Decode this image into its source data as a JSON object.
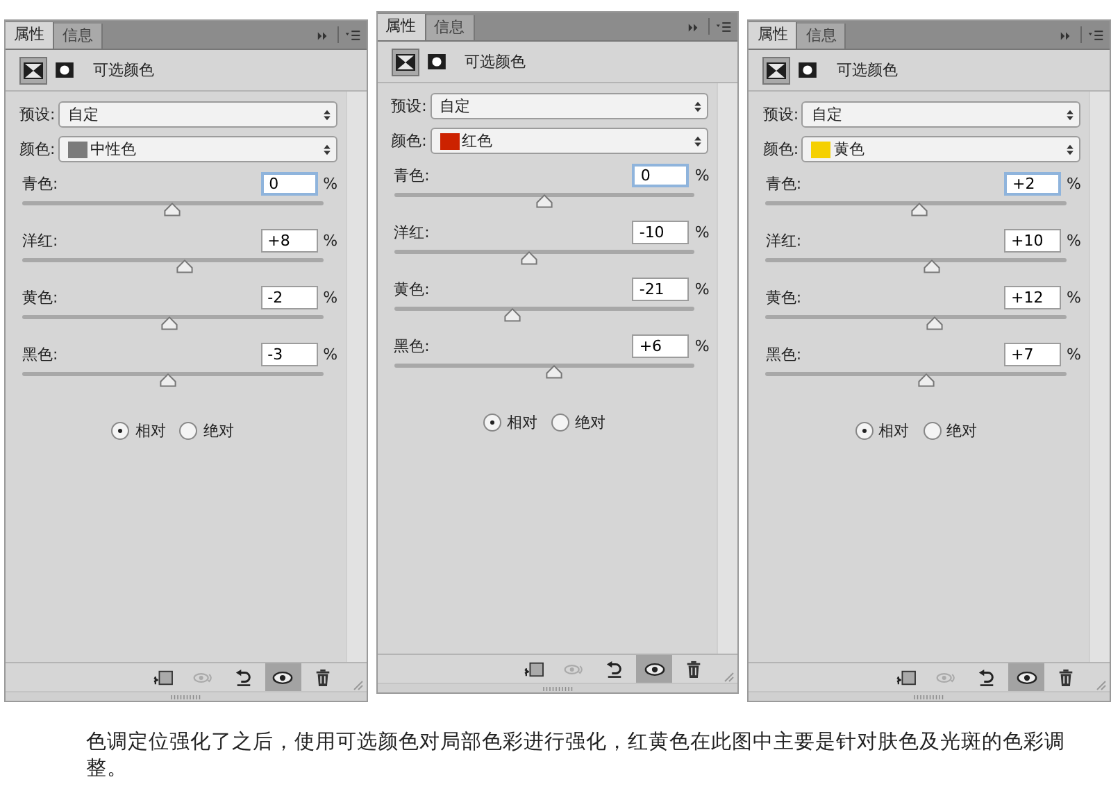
{
  "panels": [
    {
      "tabs": [
        {
          "label": "属性",
          "selected": true
        },
        {
          "label": "信息",
          "selected": false
        }
      ],
      "title": "可选颜色",
      "preset": {
        "label": "预设:",
        "value": "自定"
      },
      "color_select": {
        "label": "颜色:",
        "value": "中性色",
        "color": "#7b7b7b"
      },
      "sliders": [
        {
          "label": "青色:",
          "value": "0",
          "unit": "%",
          "level": 0.5,
          "focused": true
        },
        {
          "label": "洋红:",
          "value": "+8",
          "unit": "%",
          "level": 0.54,
          "focused": false
        },
        {
          "label": "黄色:",
          "value": "-2",
          "unit": "%",
          "level": 0.49,
          "focused": false
        },
        {
          "label": "黑色:",
          "value": "-3",
          "unit": "%",
          "level": 0.485,
          "focused": false
        }
      ],
      "method": [
        {
          "label": "相对",
          "selected": true
        },
        {
          "label": "绝对",
          "selected": false
        }
      ]
    },
    {
      "tabs": [
        {
          "label": "属性",
          "selected": true
        },
        {
          "label": "信息",
          "selected": false
        }
      ],
      "title": "可选颜色",
      "preset": {
        "label": "预设:",
        "value": "自定"
      },
      "color_select": {
        "label": "颜色:",
        "value": "红色",
        "color": "#cc2200"
      },
      "sliders": [
        {
          "label": "青色:",
          "value": "0",
          "unit": "%",
          "level": 0.5,
          "focused": true
        },
        {
          "label": "洋红:",
          "value": "-10",
          "unit": "%",
          "level": 0.45,
          "focused": false
        },
        {
          "label": "黄色:",
          "value": "-21",
          "unit": "%",
          "level": 0.395,
          "focused": false
        },
        {
          "label": "黑色:",
          "value": "+6",
          "unit": "%",
          "level": 0.53,
          "focused": false
        }
      ],
      "method": [
        {
          "label": "相对",
          "selected": true
        },
        {
          "label": "绝对",
          "selected": false
        }
      ]
    },
    {
      "tabs": [
        {
          "label": "属性",
          "selected": true
        },
        {
          "label": "信息",
          "selected": false
        }
      ],
      "title": "可选颜色",
      "preset": {
        "label": "预设:",
        "value": "自定"
      },
      "color_select": {
        "label": "颜色:",
        "value": "黄色",
        "color": "#f5d000"
      },
      "sliders": [
        {
          "label": "青色:",
          "value": "+2",
          "unit": "%",
          "level": 0.51,
          "focused": true
        },
        {
          "label": "洋红:",
          "value": "+10",
          "unit": "%",
          "level": 0.55,
          "focused": false
        },
        {
          "label": "黄色:",
          "value": "+12",
          "unit": "%",
          "level": 0.56,
          "focused": false
        },
        {
          "label": "黑色:",
          "value": "+7",
          "unit": "%",
          "level": 0.535,
          "focused": false
        }
      ],
      "method": [
        {
          "label": "相对",
          "selected": true
        },
        {
          "label": "绝对",
          "selected": false
        }
      ]
    }
  ],
  "caption": "色调定位强化了之后，使用可选颜色对局部色彩进行强化，红黄色在此图中主要是针对肤色及光斑的色彩调整。"
}
